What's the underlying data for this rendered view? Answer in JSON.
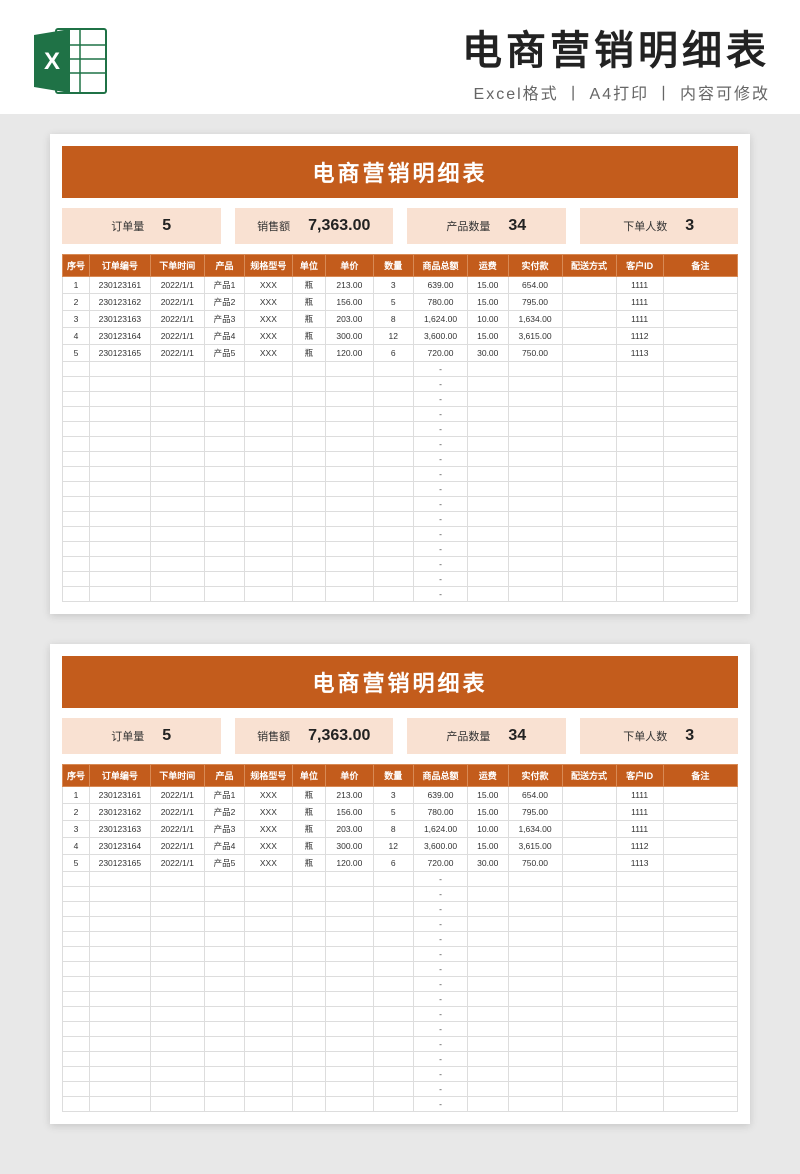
{
  "header": {
    "title": "电商营销明细表",
    "subtitle": "Excel格式 丨 A4打印 丨 内容可修改"
  },
  "sheet": {
    "title": "电商营销明细表",
    "kpis": [
      {
        "label": "订单量",
        "value": "5"
      },
      {
        "label": "销售额",
        "value": "7,363.00"
      },
      {
        "label": "产品数量",
        "value": "34"
      },
      {
        "label": "下单人数",
        "value": "3"
      }
    ],
    "columns": [
      "序号",
      "订单编号",
      "下单时间",
      "产品",
      "规格型号",
      "单位",
      "单价",
      "数量",
      "商品总额",
      "运费",
      "实付款",
      "配送方式",
      "客户ID",
      "备注"
    ],
    "rows": [
      {
        "seq": "1",
        "orderNo": "230123161",
        "time": "2022/1/1",
        "product": "产品1",
        "spec": "XXX",
        "unit": "瓶",
        "price": "213.00",
        "qty": "3",
        "total": "639.00",
        "ship": "15.00",
        "pay": "654.00",
        "deliv": "",
        "cust": "1111",
        "note": ""
      },
      {
        "seq": "2",
        "orderNo": "230123162",
        "time": "2022/1/1",
        "product": "产品2",
        "spec": "XXX",
        "unit": "瓶",
        "price": "156.00",
        "qty": "5",
        "total": "780.00",
        "ship": "15.00",
        "pay": "795.00",
        "deliv": "",
        "cust": "1111",
        "note": ""
      },
      {
        "seq": "3",
        "orderNo": "230123163",
        "time": "2022/1/1",
        "product": "产品3",
        "spec": "XXX",
        "unit": "瓶",
        "price": "203.00",
        "qty": "8",
        "total": "1,624.00",
        "ship": "10.00",
        "pay": "1,634.00",
        "deliv": "",
        "cust": "1111",
        "note": ""
      },
      {
        "seq": "4",
        "orderNo": "230123164",
        "time": "2022/1/1",
        "product": "产品4",
        "spec": "XXX",
        "unit": "瓶",
        "price": "300.00",
        "qty": "12",
        "total": "3,600.00",
        "ship": "15.00",
        "pay": "3,615.00",
        "deliv": "",
        "cust": "1112",
        "note": ""
      },
      {
        "seq": "5",
        "orderNo": "230123165",
        "time": "2022/1/1",
        "product": "产品5",
        "spec": "XXX",
        "unit": "瓶",
        "price": "120.00",
        "qty": "6",
        "total": "720.00",
        "ship": "30.00",
        "pay": "750.00",
        "deliv": "",
        "cust": "1113",
        "note": ""
      }
    ],
    "emptyRows": 16,
    "dash": "-"
  }
}
